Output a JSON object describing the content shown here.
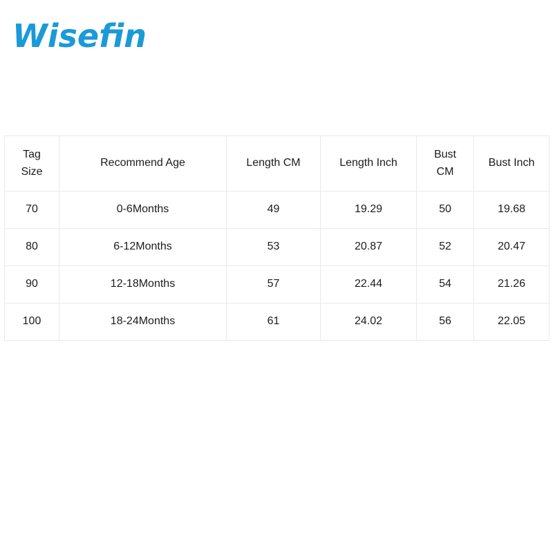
{
  "brand": {
    "name": "Wisefin",
    "logo_color": "#1a9ad8",
    "icon": "brand-wordmark"
  },
  "table": {
    "columns": [
      {
        "id": "tag_size",
        "lines": [
          "Tag",
          "Size"
        ]
      },
      {
        "id": "recommend_age",
        "lines": [
          "Recommend Age"
        ]
      },
      {
        "id": "length_cm",
        "lines": [
          "Length CM"
        ]
      },
      {
        "id": "length_inch",
        "lines": [
          "Length Inch"
        ]
      },
      {
        "id": "bust_cm",
        "lines": [
          "Bust",
          "CM"
        ]
      },
      {
        "id": "bust_inch",
        "lines": [
          "Bust Inch"
        ]
      }
    ],
    "rows": [
      {
        "tag_size": "70",
        "recommend_age": "0-6Months",
        "length_cm": "49",
        "length_inch": "19.29",
        "bust_cm": "50",
        "bust_inch": "19.68"
      },
      {
        "tag_size": "80",
        "recommend_age": "6-12Months",
        "length_cm": "53",
        "length_inch": "20.87",
        "bust_cm": "52",
        "bust_inch": "20.47"
      },
      {
        "tag_size": "90",
        "recommend_age": "12-18Months",
        "length_cm": "57",
        "length_inch": "22.44",
        "bust_cm": "54",
        "bust_inch": "21.26"
      },
      {
        "tag_size": "100",
        "recommend_age": "18-24Months",
        "length_cm": "61",
        "length_inch": "24.02",
        "bust_cm": "56",
        "bust_inch": "22.05"
      }
    ]
  },
  "style": {
    "border_color": "#e9e9e9",
    "text_color": "#1b1b1b",
    "background": "#ffffff"
  }
}
